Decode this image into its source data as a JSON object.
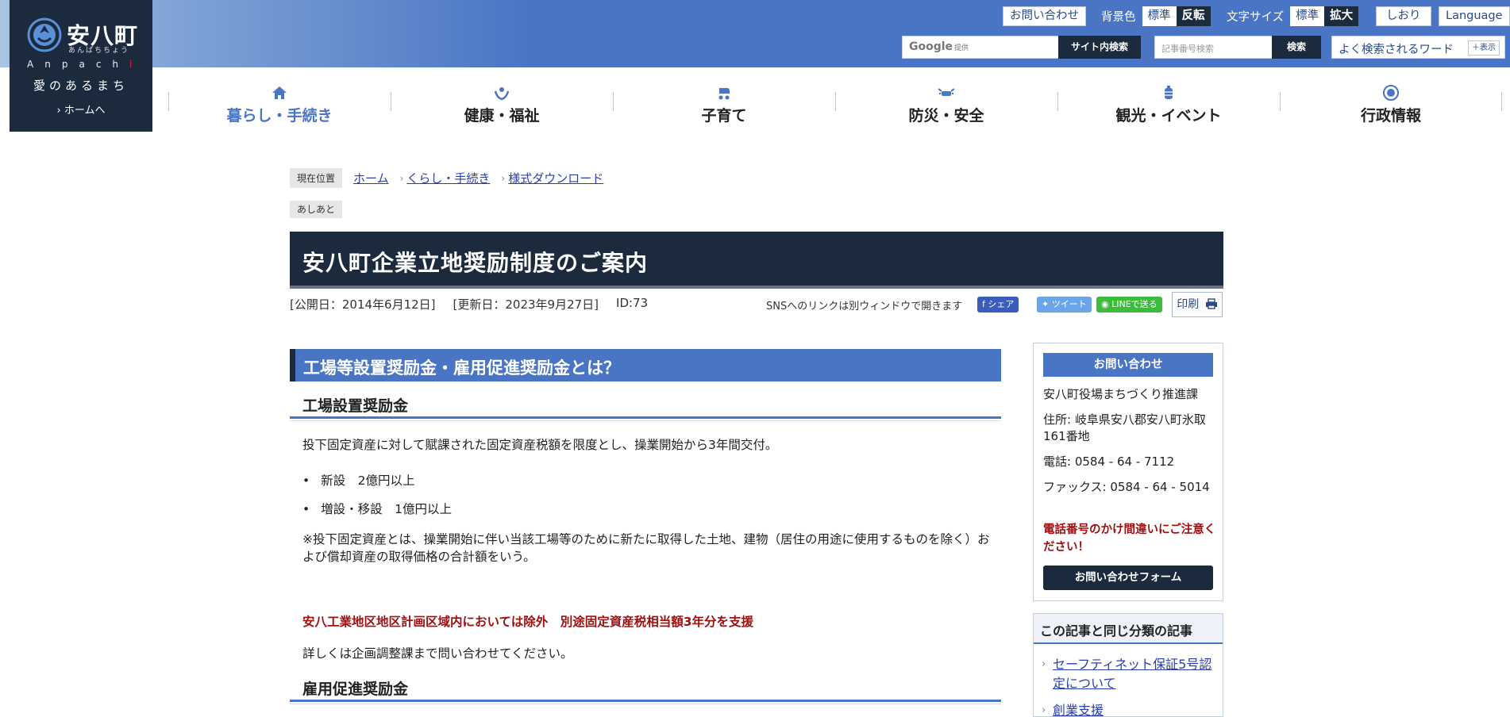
{
  "logo": {
    "name": "安八町",
    "kana": "あんぱちちょう",
    "roman_letters": [
      "A",
      "n",
      "p",
      "a",
      "c",
      "h",
      "i"
    ],
    "tagline": "愛のあるまち",
    "home_link": "ホームへ"
  },
  "utility": {
    "contact": "お問い合わせ",
    "bg_color_label": "背景色",
    "bg_standard": "標準",
    "bg_invert": "反転",
    "font_size_label": "文字サイズ",
    "font_standard": "標準",
    "font_large": "拡大",
    "bookmark": "しおり",
    "language": "Language"
  },
  "search": {
    "google_label": "Google",
    "google_provided": "提供",
    "site_search_button": "サイト内検索",
    "article_id_placeholder": "記事番号検索",
    "article_id_button": "検索",
    "popular_words": "よく検索されるワード",
    "popular_toggle": "表示"
  },
  "gnav": [
    {
      "label": "暮らし・手続き",
      "icon": "house-icon",
      "active": true
    },
    {
      "label": "健康・福祉",
      "icon": "care-hands-icon",
      "active": false
    },
    {
      "label": "子育て",
      "icon": "stroller-icon",
      "active": false
    },
    {
      "label": "防災・安全",
      "icon": "alarm-light-icon",
      "active": false
    },
    {
      "label": "観光・イベント",
      "icon": "lantern-icon",
      "active": false
    },
    {
      "label": "行政情報",
      "icon": "town-emblem-icon",
      "active": false
    }
  ],
  "breadcrumb": {
    "current_label": "現在位置",
    "items": [
      "ホーム",
      "くらし・手続き",
      "様式ダウンロード"
    ],
    "ashiato": "あしあと"
  },
  "article": {
    "title": "安八町企業立地奨励制度のご案内",
    "published": "[公開日：2014年6月12日]",
    "updated": "[更新日：2023年9月27日]",
    "id": "ID:73",
    "sns_note": "SNSへのリンクは別ウィンドウで開きます",
    "sns_facebook": "シェア",
    "sns_twitter": "ツイート",
    "sns_line": "LINEで送る",
    "print": "印刷",
    "h2": "工場等設置奨励金・雇用促進奨励金とは？",
    "h3_factory": "工場設置奨励金",
    "para_factory": "投下固定資産に対して賦課された固定資産税額を限度とし、操業開始から3年間交付。",
    "bullets": [
      "新設　2億円以上",
      "増設・移設　1億円以上"
    ],
    "note": "※投下固定資産とは、操業開始に伴い当該工場等のために新たに取得した土地、建物（居住の用途に使用するものを除く）および償却資産の取得価格の合計額をいう。",
    "red_note": "安八工業地区地区計画区域内においては除外　別途固定資産税相当額3年分を支援",
    "detail": "詳しくは企画調整課まで問い合わせてください。",
    "h3_employment": "雇用促進奨励金"
  },
  "sidebar": {
    "contact_heading": "お問い合わせ",
    "dept": "安八町役場まちづくり推進課",
    "address": "住所: 岐阜県安八郡安八町氷取161番地",
    "phone": "電話: 0584 - 64 - 7112",
    "fax": "ファックス: 0584 - 64 - 5014",
    "warning": "電話番号のかけ間違いにご注意ください！",
    "form_button": "お問い合わせフォーム",
    "related_heading": "この記事と同じ分類の記事",
    "related": [
      "セーフティネット保証5号認定について",
      "創業支援"
    ]
  },
  "colors": {
    "navy": "#1b2a3d",
    "blue": "#4a75c4",
    "red": "#a01010",
    "link": "#2a3eaa"
  }
}
